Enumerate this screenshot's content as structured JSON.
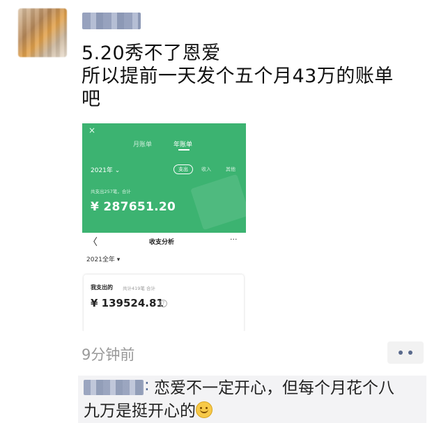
{
  "post": {
    "lines": [
      "5.20秀不了恩爱",
      "所以提前一天发个五个月43万的账单",
      "吧"
    ]
  },
  "screenshot": {
    "close_glyph": "×",
    "tabs": [
      "月账单",
      "年账单"
    ],
    "year_select": "2021年 ⌄",
    "type_chips": [
      "支出",
      "收入",
      "其他"
    ],
    "summary": "共支出257笔，合计",
    "total": "¥ 287651.20",
    "back_glyph": "〈",
    "page_title": "收支分析",
    "more_glyph": "···",
    "year_range": "2021全年 ▾",
    "card_title": "我支出的",
    "card_sub": "共计419笔 合计",
    "card_amount": "¥ 139524.81",
    "info_glyph": "?"
  },
  "meta": {
    "time": "9分钟前"
  },
  "comment": {
    "colon": ":",
    "line1": "恋爱不一定开心，但每个月花个八",
    "line2": "九万是挺开心的",
    "emoji_icon": "smile-icon"
  }
}
